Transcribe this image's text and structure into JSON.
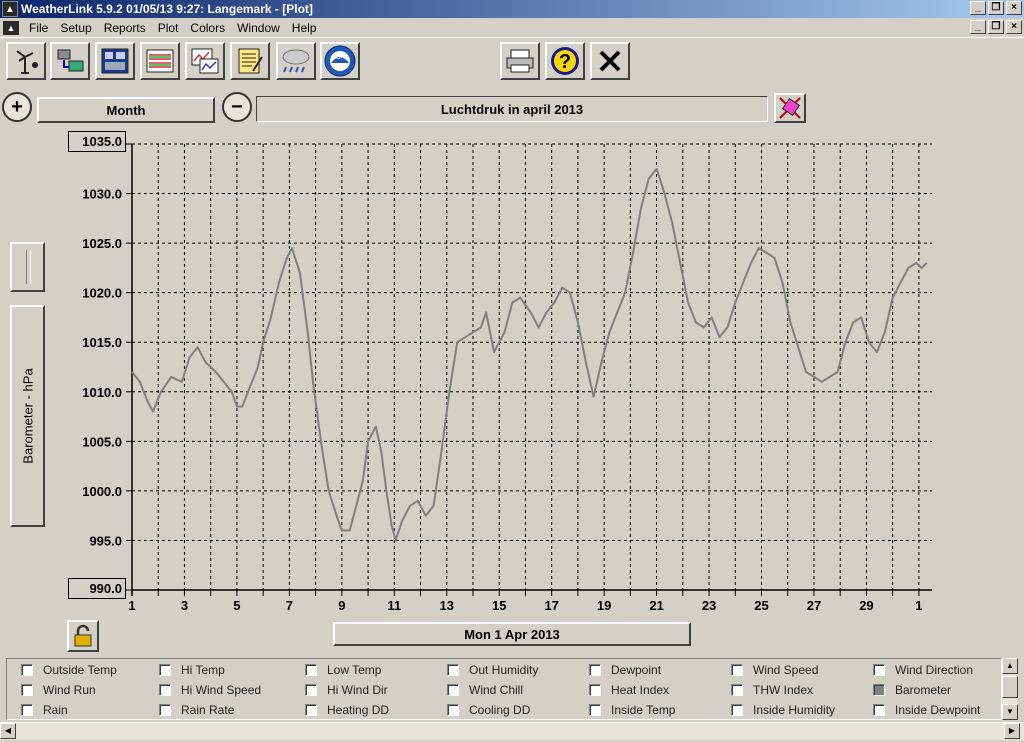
{
  "window": {
    "title": "WeatherLink 5.9.2  01/05/13  9:27: Langemark - [Plot]"
  },
  "menu": [
    "File",
    "Setup",
    "Reports",
    "Plot",
    "Colors",
    "Window",
    "Help"
  ],
  "toolbar_icons": [
    "station-icon",
    "download-icon",
    "bulletin-icon",
    "summary-icon",
    "plot-icon",
    "notes-icon",
    "weather-icon",
    "noaa-icon",
    "print-icon",
    "help-icon",
    "close-icon"
  ],
  "noaa_text": "NOAA",
  "period": {
    "label": "Month",
    "plot_title": "Luchtdruk  in april 2013"
  },
  "yaxis": {
    "label": "Barometer - hPa",
    "top": "1035.0",
    "bottom": "990.0"
  },
  "date_button": "Mon 1 Apr 2013",
  "chart_data": {
    "type": "line",
    "title": "Luchtdruk  in april 2013",
    "ylabel": "Barometer - hPa",
    "xlabel": "",
    "ylim": [
      990,
      1035
    ],
    "xlim": [
      1,
      31.5
    ],
    "grid": true,
    "y_tick_labels": [
      "1035.0",
      "1030.0",
      "1025.0",
      "1020.0",
      "1015.0",
      "1010.0",
      "1005.0",
      "1000.0",
      "995.0",
      "990.0"
    ],
    "x_tick_labels": [
      "1",
      "3",
      "5",
      "7",
      "9",
      "11",
      "13",
      "15",
      "17",
      "19",
      "21",
      "23",
      "25",
      "27",
      "29",
      "1"
    ],
    "series": [
      {
        "name": "Barometer",
        "color": "#808080",
        "x": [
          1.0,
          1.3,
          1.6,
          1.8,
          2.1,
          2.5,
          2.9,
          3.2,
          3.5,
          3.8,
          4.2,
          4.5,
          4.8,
          5.0,
          5.2,
          5.5,
          5.8,
          6.0,
          6.3,
          6.6,
          6.9,
          7.1,
          7.4,
          7.7,
          7.9,
          8.2,
          8.5,
          8.8,
          9.0,
          9.3,
          9.6,
          9.8,
          10.0,
          10.3,
          10.5,
          10.7,
          10.9,
          11.05,
          11.3,
          11.6,
          11.9,
          12.2,
          12.5,
          12.8,
          13.1,
          13.4,
          13.7,
          14.0,
          14.3,
          14.5,
          14.8,
          15.2,
          15.5,
          15.8,
          16.2,
          16.5,
          16.8,
          17.1,
          17.4,
          17.7,
          18.0,
          18.3,
          18.6,
          18.9,
          19.2,
          19.5,
          19.8,
          20.1,
          20.4,
          20.7,
          21.0,
          21.3,
          21.6,
          21.9,
          22.2,
          22.5,
          22.8,
          23.1,
          23.4,
          23.7,
          24.0,
          24.3,
          24.6,
          24.9,
          25.2,
          25.5,
          25.8,
          26.1,
          26.4,
          26.7,
          27.0,
          27.3,
          27.6,
          27.9,
          28.2,
          28.5,
          28.8,
          29.1,
          29.4,
          29.7,
          30.0,
          30.3,
          30.6,
          30.9,
          31.1,
          31.3
        ],
        "values": [
          1012.0,
          1011.0,
          1009.0,
          1008.0,
          1010.0,
          1011.5,
          1011.0,
          1013.5,
          1014.5,
          1013.0,
          1012.0,
          1011.0,
          1010.0,
          1008.5,
          1008.5,
          1010.5,
          1012.5,
          1015.0,
          1017.5,
          1021.0,
          1023.5,
          1024.5,
          1022.0,
          1016.0,
          1011.0,
          1005.0,
          1000.0,
          997.5,
          996.0,
          996.0,
          999.0,
          1001.0,
          1005.0,
          1006.5,
          1004.0,
          1000.0,
          996.5,
          995.0,
          997.0,
          998.5,
          999.0,
          997.5,
          998.5,
          1004.0,
          1010.0,
          1015.0,
          1015.5,
          1016.0,
          1016.5,
          1018.0,
          1014.0,
          1016.0,
          1019.0,
          1019.5,
          1018.0,
          1016.5,
          1018.0,
          1019.0,
          1020.5,
          1020.0,
          1017.0,
          1013.0,
          1009.5,
          1013.0,
          1016.0,
          1018.0,
          1020.0,
          1024.0,
          1028.5,
          1031.5,
          1032.5,
          1030.0,
          1027.0,
          1023.0,
          1019.0,
          1017.0,
          1016.5,
          1017.5,
          1015.5,
          1016.5,
          1019.0,
          1021.0,
          1023.0,
          1024.5,
          1024.0,
          1023.5,
          1021.0,
          1017.0,
          1014.5,
          1012.0,
          1011.5,
          1011.0,
          1011.5,
          1012.0,
          1015.0,
          1017.0,
          1017.5,
          1015.0,
          1014.0,
          1016.0,
          1019.5,
          1021.0,
          1022.5,
          1023.0,
          1022.5,
          1023.0
        ]
      }
    ]
  },
  "legend": {
    "items": [
      {
        "label": "Outside Temp",
        "checked": false
      },
      {
        "label": "Hi Temp",
        "checked": false
      },
      {
        "label": "Low Temp",
        "checked": false
      },
      {
        "label": "Out Humidity",
        "checked": false
      },
      {
        "label": "Dewpoint",
        "checked": false
      },
      {
        "label": "Wind Speed",
        "checked": false
      },
      {
        "label": "Wind Direction",
        "checked": false
      },
      {
        "label": "Wind Run",
        "checked": false
      },
      {
        "label": "Hi Wind Speed",
        "checked": false
      },
      {
        "label": "Hi Wind Dir",
        "checked": false
      },
      {
        "label": "Wind Chill",
        "checked": false
      },
      {
        "label": "Heat Index",
        "checked": false
      },
      {
        "label": "THW Index",
        "checked": false
      },
      {
        "label": "Barometer",
        "checked": true
      },
      {
        "label": "Rain",
        "checked": false
      },
      {
        "label": "Rain Rate",
        "checked": false
      },
      {
        "label": "Heating DD",
        "checked": false
      },
      {
        "label": "Cooling DD",
        "checked": false
      },
      {
        "label": "Inside Temp",
        "checked": false
      },
      {
        "label": "Inside Humidity",
        "checked": false
      },
      {
        "label": "Inside Dewpoint",
        "checked": false
      }
    ]
  },
  "colors": {
    "background": "#d4d0c8",
    "series_line": "#808080",
    "grid": "#000000",
    "title_bar": "#0a246a"
  }
}
